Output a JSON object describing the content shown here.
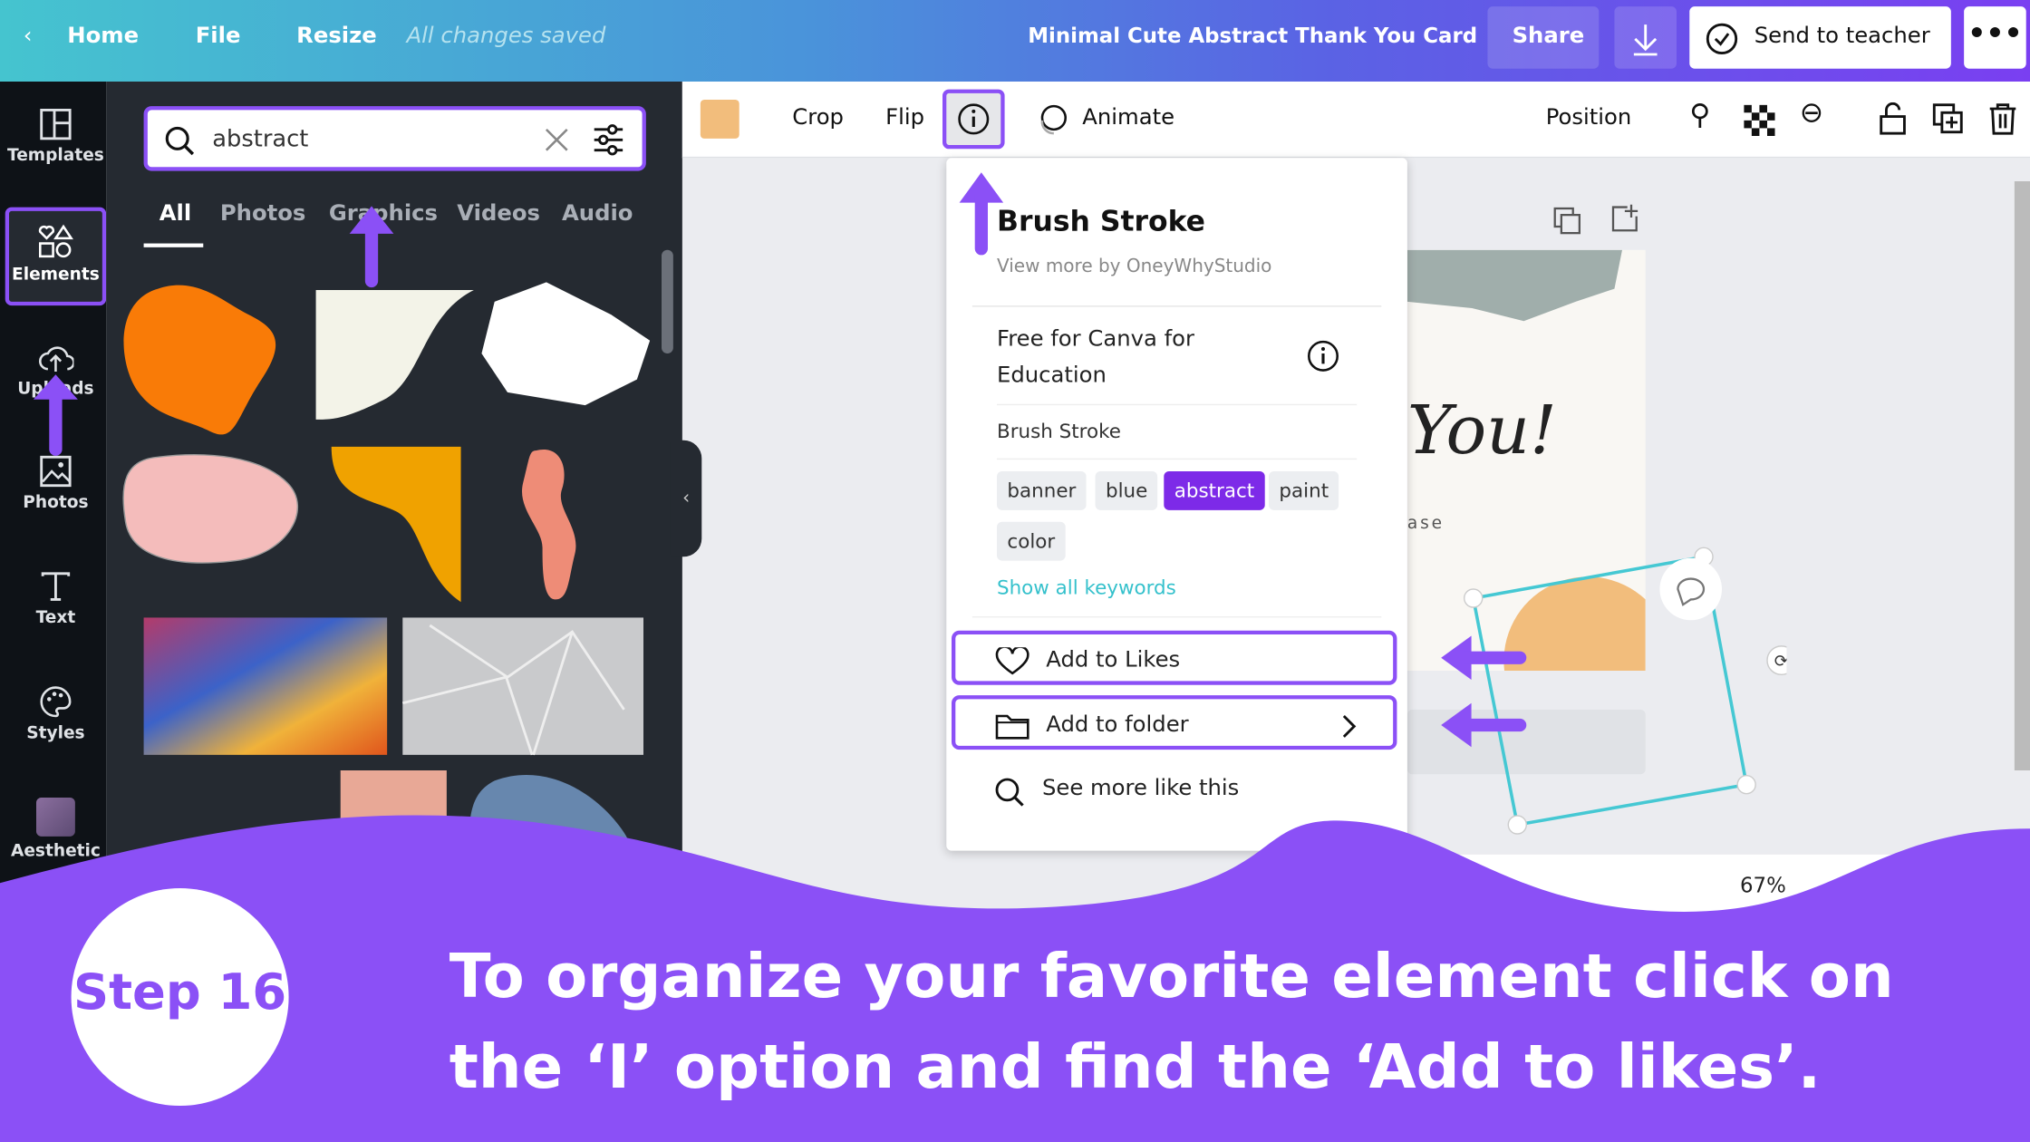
{
  "header": {
    "back_label": "Home",
    "file": "File",
    "resize": "Resize",
    "save_status": "All changes saved",
    "title": "Minimal Cute Abstract Thank You Card",
    "share": "Share",
    "send_to_teacher": "Send to teacher"
  },
  "rail": [
    {
      "label": "Templates"
    },
    {
      "label": "Elements"
    },
    {
      "label": "Uploads"
    },
    {
      "label": "Photos"
    },
    {
      "label": "Text"
    },
    {
      "label": "Styles"
    },
    {
      "label": "Aesthetic"
    }
  ],
  "panel": {
    "search_value": "abstract",
    "tabs": [
      "All",
      "Photos",
      "Graphics",
      "Videos",
      "Audio"
    ],
    "active_tab": "All"
  },
  "toolbar": {
    "color_swatch": "#f2bd7c",
    "crop": "Crop",
    "flip": "Flip",
    "animate": "Animate",
    "position": "Position"
  },
  "popup": {
    "title": "Brush Stroke",
    "author_link": "View more by OneyWhyStudio",
    "license_line1": "Free for Canva for",
    "license_line2": "Education",
    "name": "Brush Stroke",
    "keywords": [
      "banner",
      "blue",
      "abstract",
      "paint",
      "color"
    ],
    "active_keyword": "abstract",
    "show_all": "Show all keywords",
    "add_likes": "Add to Likes",
    "add_folder": "Add to folder",
    "see_more": "See more like this"
  },
  "canvas": {
    "card_text": "You!",
    "card_small": "ase",
    "zoom": "67%"
  },
  "banner": {
    "step": "Step 16",
    "caption": "To organize your favorite element click on the ‘I’ option and find the ‘Add to likes’."
  },
  "colors": {
    "accent": "#8b50f6",
    "teal": "#45c4cf"
  }
}
